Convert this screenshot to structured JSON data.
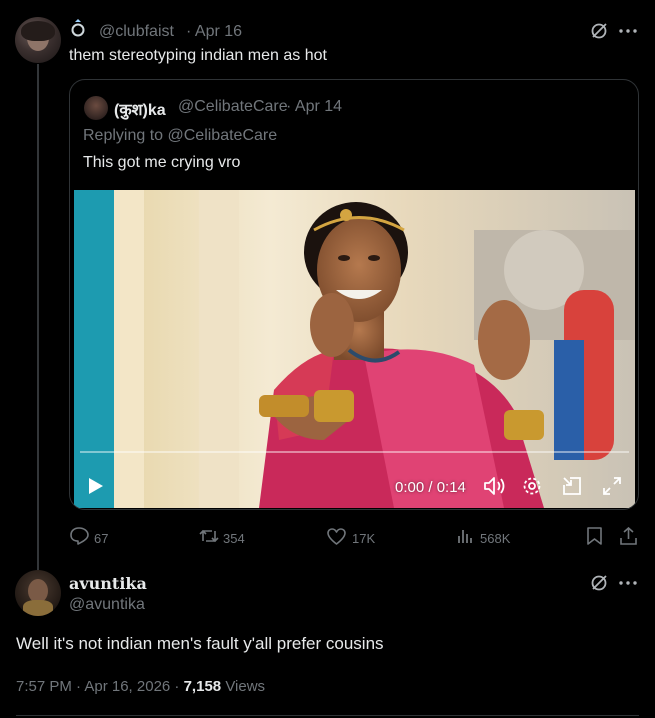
{
  "tweet1": {
    "handle": "@clubfaist",
    "date": "· Apr 16",
    "text": "them stereotyping indian men as hot"
  },
  "quote": {
    "name": "(कुश)ka",
    "handle": "@CelibateCare",
    "date": "· Apr 14",
    "replying_to": "Replying to @CelibateCare",
    "text": "This got me crying vro",
    "video_time": "0:00 / 0:14",
    "progress": 0
  },
  "actions": {
    "replies": "67",
    "reposts": "354",
    "likes": "17K",
    "views": "568K"
  },
  "tweet2": {
    "name": "avuntika",
    "handle": "@avuntika",
    "text": "Well it's not indian men's fault y'all prefer cousins",
    "timestamp": "7:57 PM · Apr 16, 2026 · ",
    "views_count": "7,158",
    "views_label": "Views"
  },
  "colors": {
    "background": "#000000",
    "text": "#e7e9ea",
    "muted": "#71767b",
    "border": "#2f3336"
  }
}
